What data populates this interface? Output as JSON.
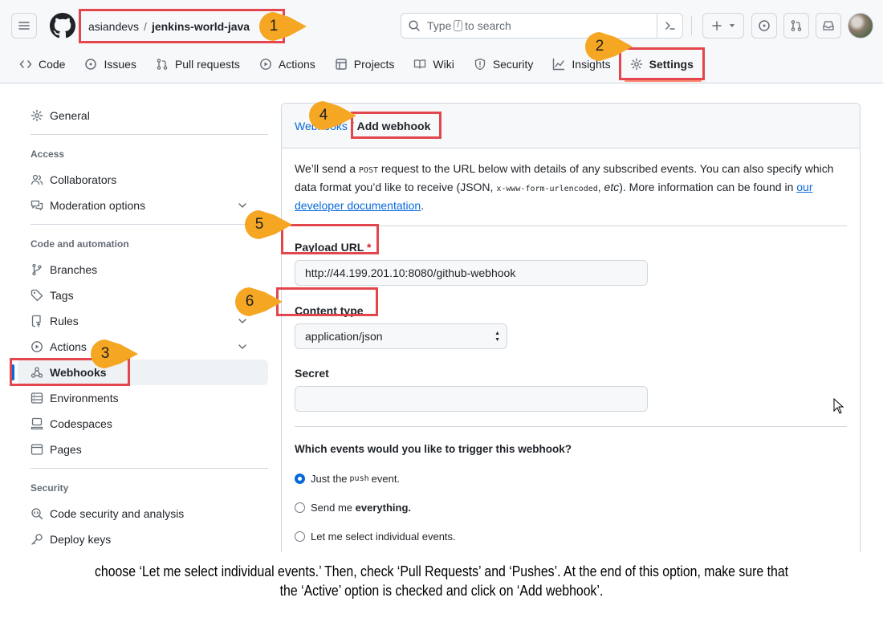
{
  "header": {
    "owner": "asiandevs",
    "separator": "/",
    "repo": "jenkins-world-java",
    "search": {
      "before": "Type",
      "key": "/",
      "after": "to search"
    },
    "icons": [
      "hamburger-icon",
      "github-logo-icon",
      "search-icon",
      "command-palette-icon",
      "plus-icon",
      "issues-icon",
      "pull-request-icon",
      "inbox-icon"
    ]
  },
  "tabs": [
    {
      "label": "Code",
      "icon": "code-icon"
    },
    {
      "label": "Issues",
      "icon": "issue-icon"
    },
    {
      "label": "Pull requests",
      "icon": "pull-request-icon"
    },
    {
      "label": "Actions",
      "icon": "play-icon"
    },
    {
      "label": "Projects",
      "icon": "table-icon"
    },
    {
      "label": "Wiki",
      "icon": "book-icon"
    },
    {
      "label": "Security",
      "icon": "shield-icon"
    },
    {
      "label": "Insights",
      "icon": "graph-icon"
    },
    {
      "label": "Settings",
      "icon": "gear-icon"
    }
  ],
  "sidebar": {
    "general": "General",
    "access_heading": "Access",
    "collaborators": "Collaborators",
    "moderation": "Moderation options",
    "code_heading": "Code and automation",
    "branches": "Branches",
    "tags": "Tags",
    "rules": "Rules",
    "actions": "Actions",
    "webhooks": "Webhooks",
    "environments": "Environments",
    "codespaces": "Codespaces",
    "pages": "Pages",
    "security_heading": "Security",
    "code_security": "Code security and analysis",
    "deploy_keys": "Deploy keys"
  },
  "main": {
    "breadcrumb_link": "Webhooks",
    "breadcrumb_sep": " / ",
    "breadcrumb_current": "Add webhook",
    "intro": {
      "p1": "We’ll send a ",
      "c1": "POST",
      "p2": " request to the URL below with details of any subscribed events. You can also specify which data format you’d like to receive (JSON, ",
      "c2": "x-www-form-urlencoded",
      "p3": ", ",
      "etc": "etc",
      "p4": "). More information can be found in ",
      "link": "our developer documentation",
      "p5": "."
    },
    "payload_label": "Payload URL",
    "required_mark": "*",
    "payload_value": "http://44.199.201.10:8080/github-webhook",
    "content_type_label": "Content type",
    "content_type_value": "application/json",
    "secret_label": "Secret",
    "secret_value": "",
    "events_question": "Which events would you like to trigger this webhook?",
    "radio_just_pre": "Just the",
    "radio_just_code": "push",
    "radio_just_post": "event.",
    "radio_everything_pre": "Send me",
    "radio_everything_bold": "everything.",
    "radio_select": "Let me select individual events.",
    "selected_event_option": "Just the push event."
  },
  "annotations": {
    "callouts": [
      "1",
      "2",
      "3",
      "4",
      "5",
      "6"
    ],
    "color": "#f5a623",
    "box_color": "#e3464c"
  },
  "caption": "choose ‘Let me select individual events.’ Then, check ‘Pull Requests’ and ‘Pushes’. At the end of this option, make sure that the ‘Active’ option is checked and click on ‘Add webhook’."
}
